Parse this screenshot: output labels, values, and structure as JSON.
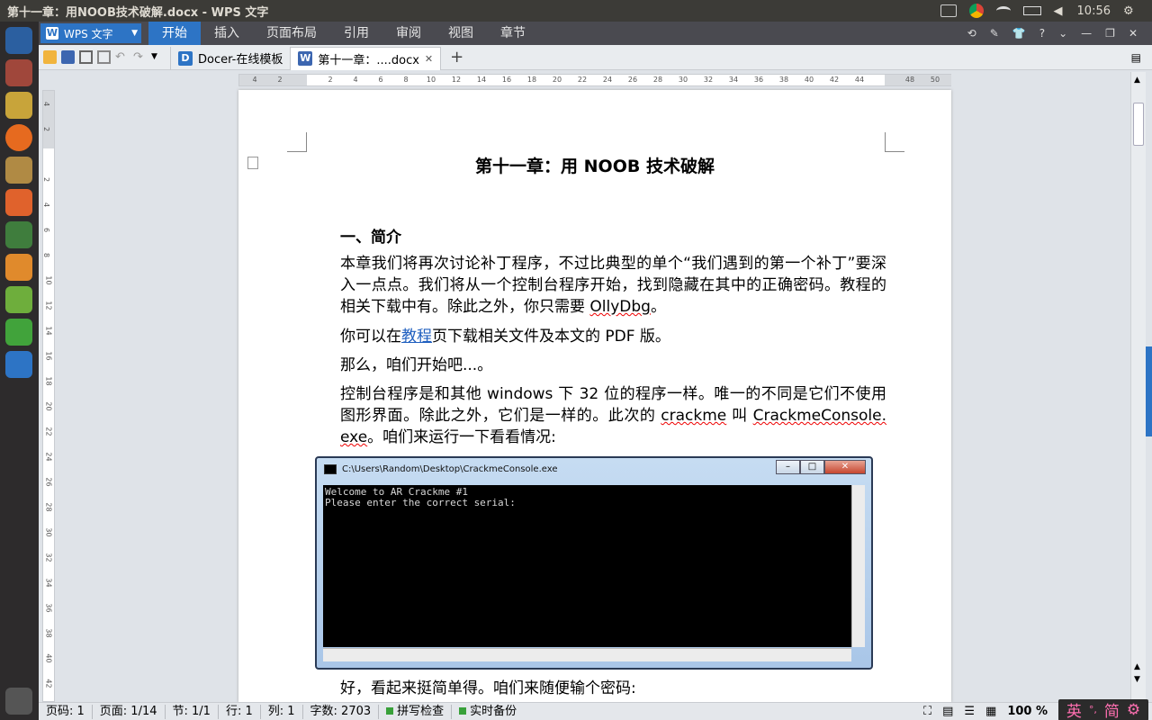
{
  "window_title": "第十一章：用NOOB技术破解.docx - WPS 文字",
  "tray": {
    "clock": "10:56"
  },
  "app_menu": {
    "wps_button": "WPS 文字",
    "items": [
      "开始",
      "插入",
      "页面布局",
      "引用",
      "审阅",
      "视图",
      "章节"
    ],
    "active_index": 0,
    "help_label": "?"
  },
  "tabs": [
    {
      "label": "Docer-在线模板",
      "icon": "docer-icon",
      "active": false
    },
    {
      "label": "第十一章：....docx",
      "icon": "doc-icon",
      "active": true
    }
  ],
  "ruler": {
    "h_numbers": [
      "4",
      "2",
      "2",
      "2",
      "4",
      "6",
      "8",
      "10",
      "12",
      "14",
      "16",
      "18",
      "20",
      "22",
      "24",
      "26",
      "28",
      "30",
      "32",
      "34",
      "36",
      "38",
      "40",
      "42",
      "44",
      "48",
      "50"
    ],
    "v_numbers": [
      "4",
      "2",
      "2",
      "4",
      "6",
      "8",
      "10",
      "12",
      "14",
      "16",
      "18",
      "20",
      "22",
      "24",
      "26",
      "28",
      "30",
      "32",
      "34",
      "36",
      "38",
      "40",
      "42"
    ]
  },
  "document": {
    "title": "第十一章：用 NOOB 技术破解",
    "heading1": "一、简介",
    "p1": "本章我们将再次讨论补丁程序，不过比典型的单个“我们遇到的第一个补丁”要深入一点点。我们将从一个控制台程序开始，找到隐藏在其中的正确密码。教程的相关下载中有。除此之外，你只需要 ",
    "p1_word": "OllyDbg",
    "p1_end": "。",
    "p2_before": "你可以在",
    "p2_link": "教程",
    "p2_after": "页下载相关文件及本文的 PDF 版。",
    "p3": "那么，咱们开始吧...。",
    "p4_a": "控制台程序是和其他 windows 下 32 位的程序一样。唯一的不同是它们不使用图形界面。除此之外，它们是一样的。此次的 ",
    "p4_w1": "crackme",
    "p4_b": " 叫 ",
    "p4_w2": "CrackmeConsole. exe",
    "p4_c": "。咱们来运行一下看看情况:",
    "p5": "好，看起来挺简单得。咱们来随便输个密码:"
  },
  "console": {
    "title": "C:\\Users\\Random\\Desktop\\CrackmeConsole.exe",
    "lines": [
      "Welcome to AR Crackme #1",
      "Please enter the correct serial:"
    ],
    "btn_min": "–",
    "btn_max": "□",
    "btn_close": "✕"
  },
  "status": {
    "page_no": "页码: 1",
    "page": "页面: 1/14",
    "section": "节: 1/1",
    "row": "行: 1",
    "col": "列: 1",
    "words": "字数: 2703",
    "spell": "拼写检查",
    "backup": "实时备份",
    "zoom": "100 %",
    "ime_lang": "英",
    "ime_mode": "简"
  },
  "colors": {
    "accent": "#2d74c5",
    "link": "#1f5fbf"
  }
}
